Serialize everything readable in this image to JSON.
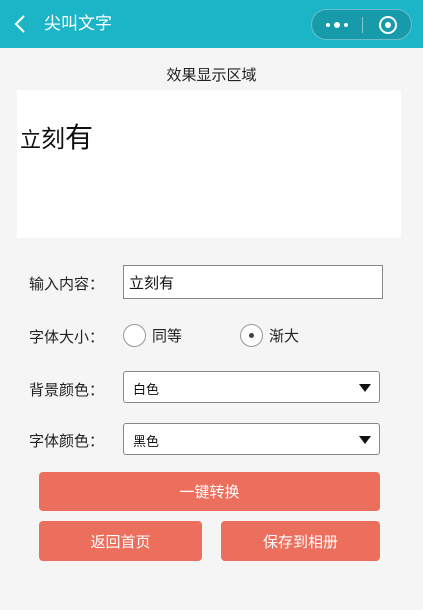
{
  "nav": {
    "title": "尖叫文字",
    "back_icon": "chevron-left-icon",
    "more_icon": "more-dots-icon",
    "close_icon": "target-circle-icon"
  },
  "preview": {
    "section_title": "效果显示区域",
    "chars": [
      "立",
      "刻",
      "有"
    ]
  },
  "content_row": {
    "label": "输入内容：",
    "value": "立刻有"
  },
  "size_row": {
    "label": "字体大小：",
    "options": [
      {
        "label": "同等",
        "selected": false
      },
      {
        "label": "渐大",
        "selected": true
      }
    ]
  },
  "bg_row": {
    "label": "背景颜色：",
    "value": "白色"
  },
  "font_row": {
    "label": "字体颜色：",
    "value": "黑色"
  },
  "buttons": {
    "convert": "一键转换",
    "home": "返回首页",
    "save": "保存到相册"
  },
  "colors": {
    "header": "#1cb5c8",
    "button": "#ec6f5d",
    "background": "#f5f5f5"
  }
}
